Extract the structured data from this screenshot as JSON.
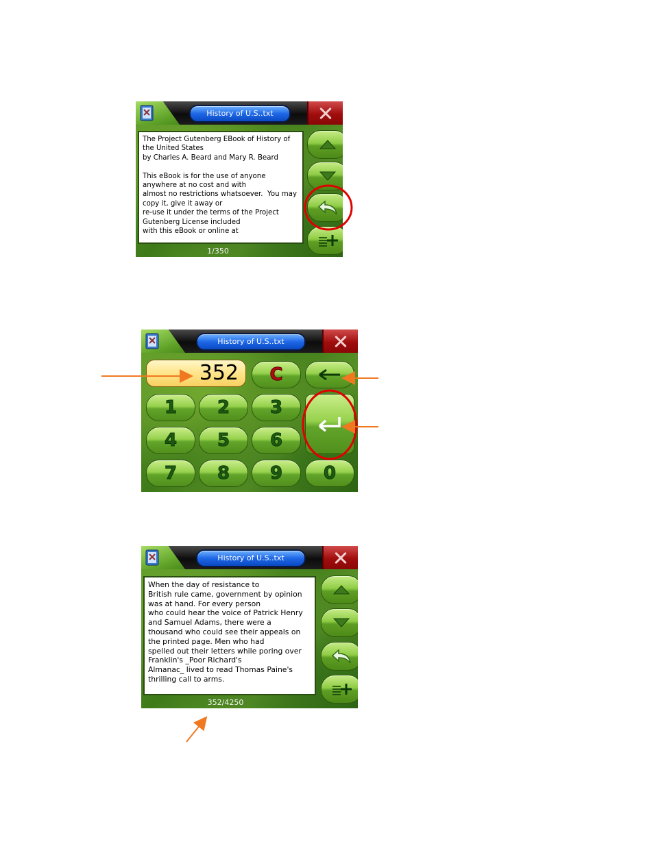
{
  "app_title": "History of U.S..txt",
  "screen_reader_1": {
    "lines": [
      "The Project Gutenberg EBook of History of",
      "the United States",
      "by Charles A. Beard and Mary R. Beard",
      "",
      "This eBook is for the use of anyone",
      "anywhere at no cost and with",
      "almost no restrictions whatsoever.  You may",
      "copy it, give it away or",
      "re-use it under the terms of the Project",
      "Gutenberg License included",
      "with this eBook or online at"
    ],
    "page_indicator": "1/350"
  },
  "screen_keypad": {
    "display_value": "352",
    "clear_label": "C",
    "digits": [
      "1",
      "2",
      "3",
      "4",
      "5",
      "6",
      "7",
      "8",
      "9",
      "0"
    ]
  },
  "screen_reader_2": {
    "lines": [
      "When the day of resistance to",
      "British rule came, government by opinion",
      "was at hand. For every person",
      "who could hear the voice of Patrick Henry",
      "and Samuel Adams, there were a",
      "thousand who could see their appeals on",
      "the printed page. Men who had",
      "spelled out their letters while poring over",
      "Franklin's _Poor Richard's",
      "Almanac_ lived to read Thomas Paine's",
      "thrilling call to arms."
    ],
    "page_indicator": "352/4250"
  },
  "colors": {
    "annotation_arrow": "#f07820",
    "highlight_circle": "#e00000",
    "button_green": "#8fcc45",
    "title_blue": "#1e67e6"
  }
}
